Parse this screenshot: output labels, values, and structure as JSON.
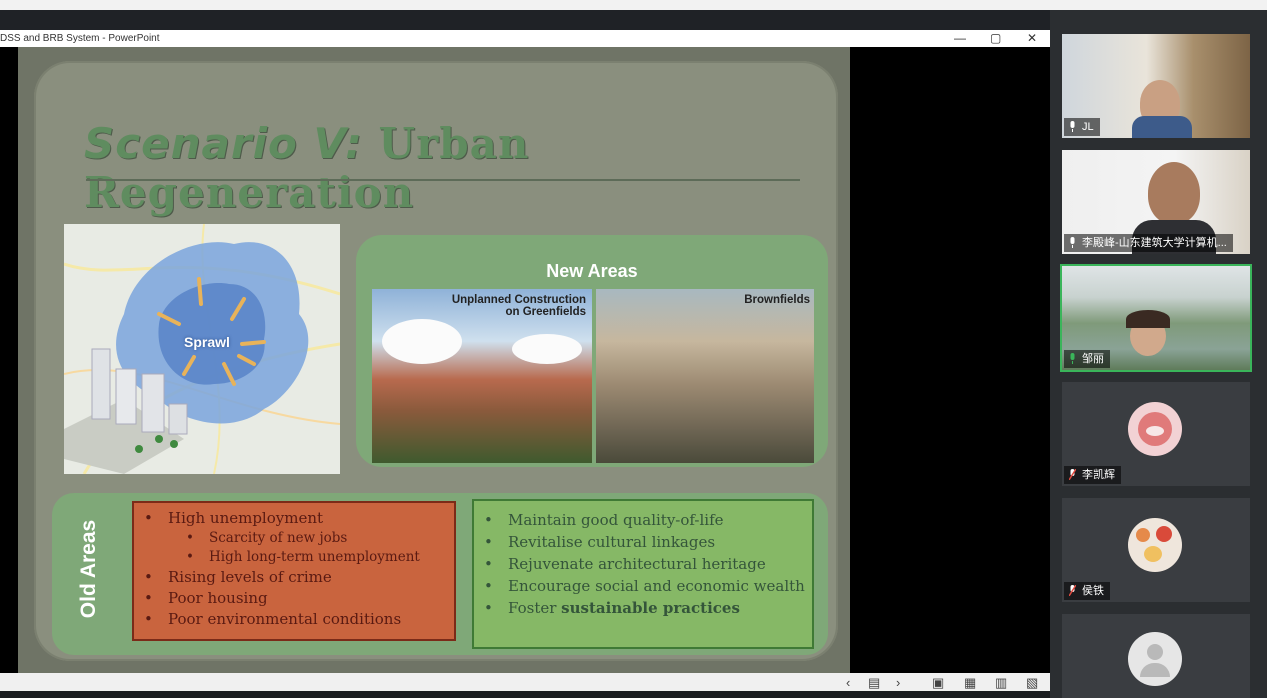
{
  "window": {
    "title": "DSS and BRB System - PowerPoint",
    "minimize": "—",
    "restore": "▢",
    "close": "✕"
  },
  "slide": {
    "title_italic": "Scenario V:",
    "title_rest": "Urban Regeneration",
    "map_label": "Sprawl",
    "new_areas_title": "New Areas",
    "photo1_label_line1": "Unplanned Construction",
    "photo1_label_line2": "on Greenfields",
    "photo2_label": "Brownfields",
    "old_areas_title": "Old Areas",
    "problems": [
      "High unemployment",
      "Scarcity of new jobs",
      "High long-term unemployment",
      "Rising levels of crime",
      "Poor housing",
      "Poor environmental conditions"
    ],
    "goals": [
      "Maintain good quality-of-life",
      "Revitalise cultural linkages",
      "Rejuvenate architectural heritage",
      "Encourage social and economic wealth",
      "Foster ",
      "sustainable practices"
    ]
  },
  "participants": [
    {
      "name": "JL",
      "mic": "on"
    },
    {
      "name": "李殿峰-山东建筑大学计算机...",
      "mic": "on"
    },
    {
      "name": "邹丽",
      "mic": "on",
      "active": true
    },
    {
      "name": "李凯辉",
      "mic": "muted"
    },
    {
      "name": "侯铁",
      "mic": "muted"
    },
    {
      "name": "",
      "mic": ""
    }
  ],
  "colors": {
    "mic_on": "#3ab55a",
    "mic_muted": "#e04a3f",
    "slide_bg": "#8a8f7e",
    "box_green": "#7fa878",
    "problems_red": "#c9643e"
  }
}
